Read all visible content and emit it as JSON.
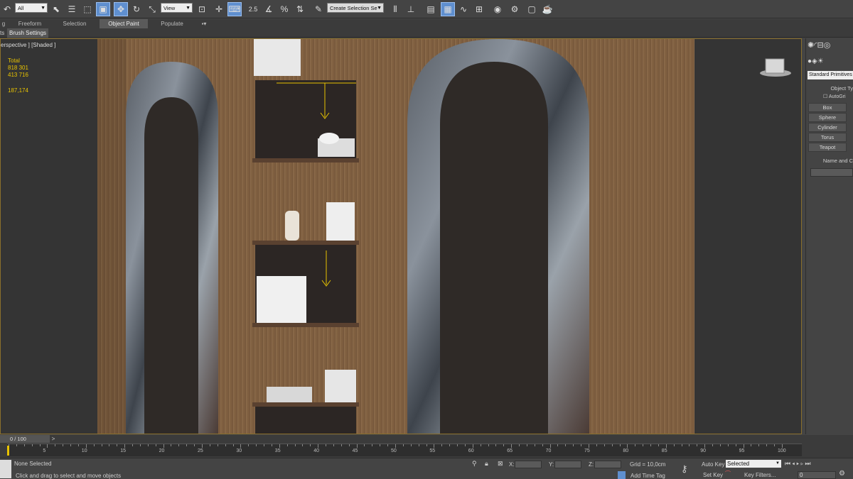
{
  "toolbar": {
    "selection_filter": "All",
    "coord_system": "View",
    "snap_angle": "2.5",
    "named_selection_placeholder": "Create Selection Se",
    "colors": {
      "bg": "#444444",
      "active": "#5f8fcf"
    }
  },
  "ribbon": {
    "tabs": [
      {
        "label": "g"
      },
      {
        "label": "Freeform"
      },
      {
        "label": "Selection"
      },
      {
        "label": "Object Paint"
      },
      {
        "label": "Populate"
      }
    ]
  },
  "subtoolbar": {
    "label_left": "ts",
    "brush_settings": "Brush Settings"
  },
  "viewport": {
    "label": "erspective ] [Shaded ]",
    "stats": {
      "title": "Total",
      "polys": "818 301",
      "verts": "413 716",
      "fps": "187,174"
    },
    "accent_color": "#e8c300"
  },
  "command_panel": {
    "category": "Standard Primitives",
    "rollout_object_type": "Object Ty",
    "autogrid": "AutoGri",
    "buttons": [
      "Box",
      "Sphere",
      "Cylinder",
      "Torus",
      "Teapot"
    ],
    "rollout_name_color": "Name and C"
  },
  "timeline": {
    "frame_counter": "0 / 100",
    "ticks": [
      "5",
      "10",
      "15",
      "20",
      "25",
      "30",
      "35",
      "40",
      "45",
      "50",
      "55",
      "60",
      "65",
      "70",
      "75",
      "80",
      "85",
      "90",
      "95",
      "100"
    ]
  },
  "status": {
    "selection": "None Selected",
    "prompt": "Click and drag to select and move objects",
    "x_label": "X:",
    "y_label": "Y:",
    "z_label": "Z:",
    "grid": "Grid = 10,0cm",
    "add_time_tag": "Add Time Tag",
    "auto_key": "Auto Key",
    "set_key": "Set Key",
    "key_mode": "Selected",
    "key_filters": "Key Filters...",
    "frame_value": "0"
  }
}
